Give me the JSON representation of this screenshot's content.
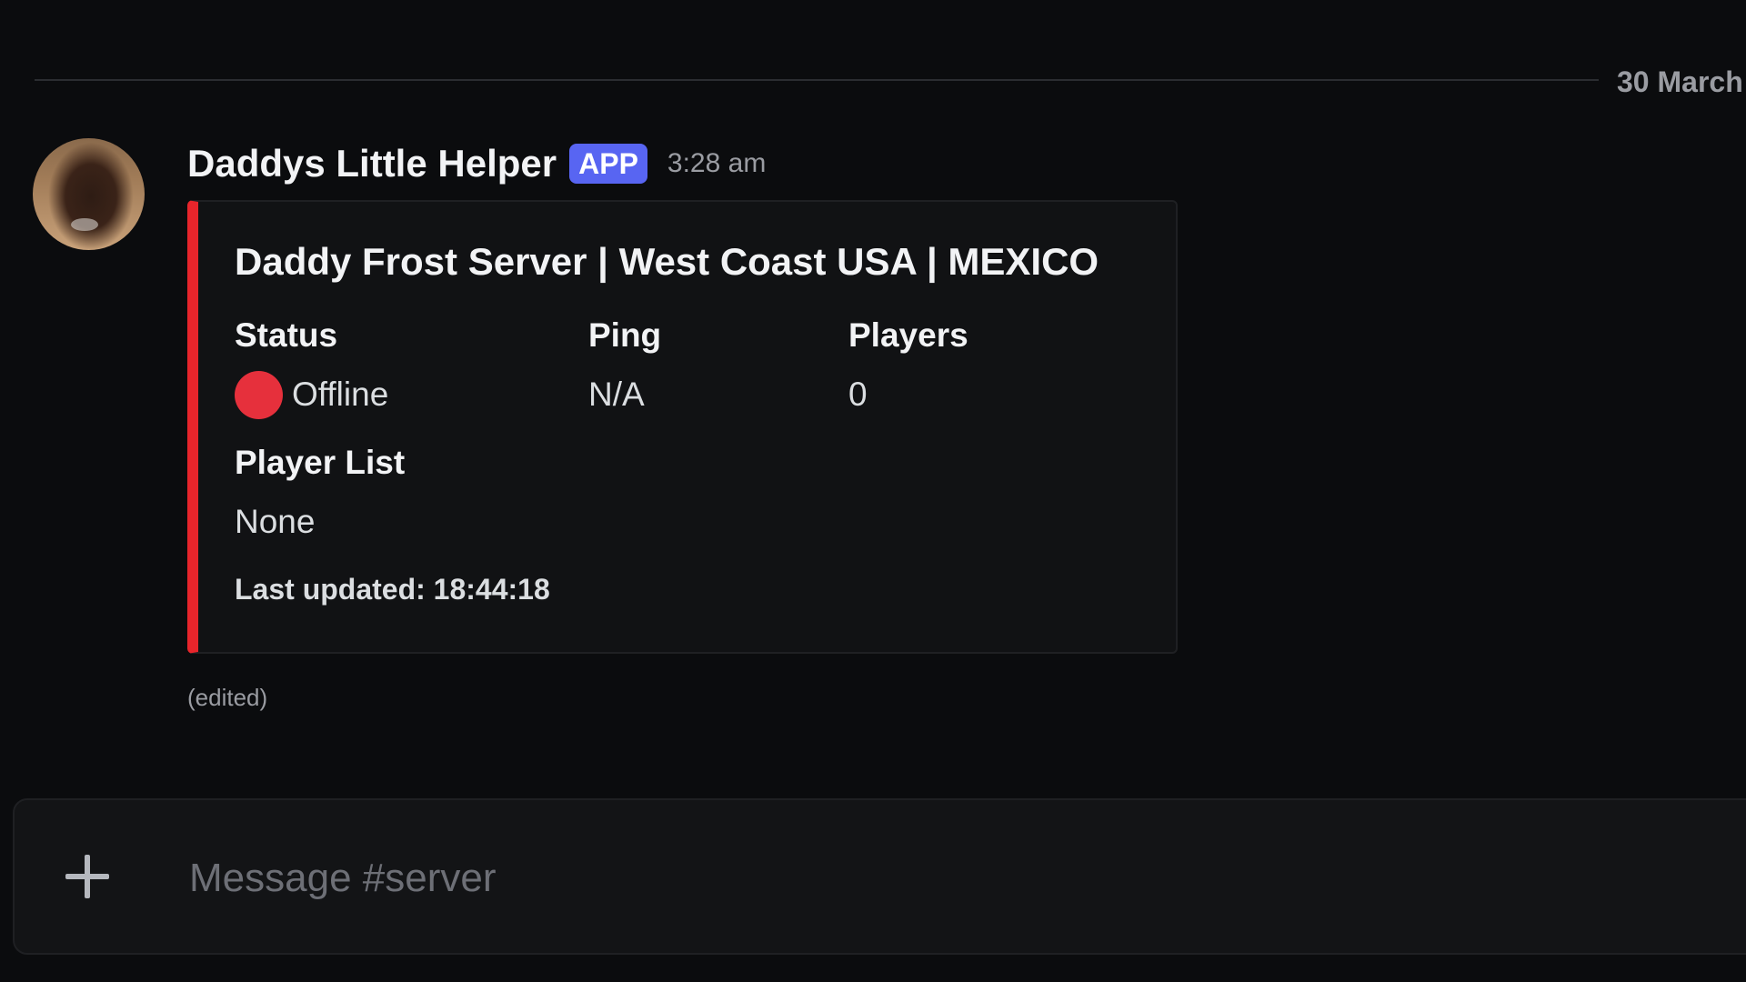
{
  "divider": {
    "date": "30 March"
  },
  "message": {
    "author": "Daddys Little Helper",
    "badge": "APP",
    "time": "3:28 am",
    "edited": "(edited)",
    "avatar_icon": "user-avatar"
  },
  "embed": {
    "accent_color": "#e8252b",
    "title": "Daddy Frost Server | West Coast USA | MEXICO",
    "fields": {
      "status": {
        "name": "Status",
        "value": "Offline",
        "icon": "red-circle-icon"
      },
      "ping": {
        "name": "Ping",
        "value": "N/A"
      },
      "players": {
        "name": "Players",
        "value": "0"
      },
      "player_list": {
        "name": "Player List",
        "value": "None"
      }
    },
    "footer": "Last updated: 18:44:18"
  },
  "composer": {
    "placeholder": "Message #server",
    "add_icon": "plus-icon"
  },
  "colors": {
    "background": "#0b0c0e",
    "badge": "#5865f2",
    "status_offline": "#e6303c"
  }
}
